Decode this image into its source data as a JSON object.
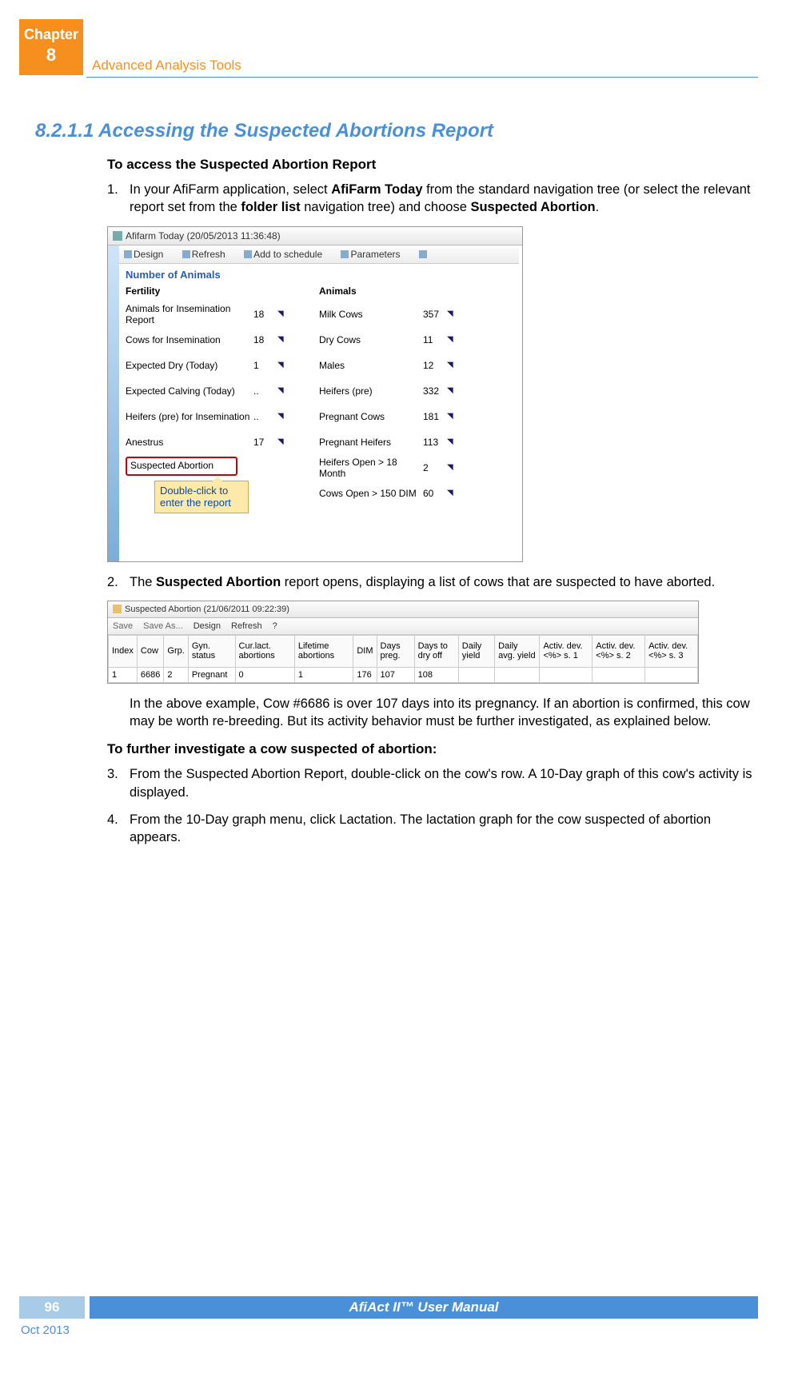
{
  "chapter": {
    "label": "Chapter",
    "num": "8"
  },
  "section_label": "Advanced Analysis Tools",
  "heading": "8.2.1.1 Accessing the Suspected Abortions Report",
  "intro_bold": "To access the Suspected Abortion Report",
  "step1_num": "1.",
  "step1_a": "In your AfiFarm application, select ",
  "step1_b": "AfiFarm Today",
  "step1_c": " from the standard navigation tree (or select the relevant report set from the ",
  "step1_d": "folder list",
  "step1_e": " navigation tree) and choose ",
  "step1_f": "Suspected Abortion",
  "step1_g": ".",
  "ss1": {
    "title": "Afifarm Today (20/05/2013 11:36:48)",
    "tb_design": "Design",
    "tb_refresh": "Refresh",
    "tb_schedule": "Add to schedule",
    "tb_params": "Parameters",
    "section_title": "Number of Animals",
    "col1_h": "Fertility",
    "col2_h": "Animals",
    "fertility": [
      {
        "lbl": "Animals for Insemination Report",
        "val": "18"
      },
      {
        "lbl": "Cows for Insemination",
        "val": "18"
      },
      {
        "lbl": "Expected Dry (Today)",
        "val": "1"
      },
      {
        "lbl": "Expected Calving (Today)",
        "val": ".."
      },
      {
        "lbl": "Heifers (pre) for Insemination",
        "val": ".."
      },
      {
        "lbl": "Anestrus",
        "val": "17"
      }
    ],
    "suspected_label": "Suspected Abortion",
    "callout": "Double-click to enter the report",
    "animals": [
      {
        "lbl": "Milk Cows",
        "val": "357"
      },
      {
        "lbl": "Dry Cows",
        "val": "11"
      },
      {
        "lbl": "Males",
        "val": "12"
      },
      {
        "lbl": "Heifers (pre)",
        "val": "332"
      },
      {
        "lbl": "Pregnant Cows",
        "val": "181"
      },
      {
        "lbl": "Pregnant Heifers",
        "val": "113"
      },
      {
        "lbl": "Heifers Open > 18 Month",
        "val": "2"
      },
      {
        "lbl": "Cows Open > 150 DIM",
        "val": "60"
      }
    ]
  },
  "step2_num": "2.",
  "step2_a": "The ",
  "step2_b": "Suspected Abortion",
  "step2_c": " report opens, displaying a list of cows that are suspected to have aborted.",
  "ss2": {
    "title": "Suspected Abortion (21/06/2011 09:22:39)",
    "tb_save": "Save",
    "tb_saveas": "Save As...",
    "tb_design": "Design",
    "tb_refresh": "Refresh",
    "headers": [
      "Index",
      "Cow",
      "Grp.",
      "Gyn. status",
      "Cur.lact. abortions",
      "Lifetime abortions",
      "DIM",
      "Days preg.",
      "Days to dry off",
      "Daily yield",
      "Daily avg. yield",
      "Activ. dev.<%> s. 1",
      "Activ. dev.<%> s. 2",
      "Activ. dev.<%> s. 3"
    ],
    "row1": [
      "1",
      "6686",
      "2",
      "Pregnant",
      "0",
      "1",
      "176",
      "107",
      "108",
      "",
      "",
      "",
      "",
      ""
    ]
  },
  "example_para": "In the above example, Cow #6686 is over 107 days into its pregnancy. If an abortion is confirmed, this cow may be worth re-breeding. But its activity behavior must be further investigated, as explained below.",
  "further_bold": "To further investigate a cow suspected of abortion:",
  "step3_num": "3.",
  "step3_t": "From the Suspected Abortion Report, double-click on the cow's row. A 10-Day graph of this cow's activity is displayed.",
  "step4_num": "4.",
  "step4_t": "From the 10-Day graph menu, click Lactation. The lactation graph for the cow suspected of abortion appears.",
  "footer": {
    "page": "96",
    "title": "AfiAct II™ User Manual",
    "date": "Oct 2013"
  }
}
